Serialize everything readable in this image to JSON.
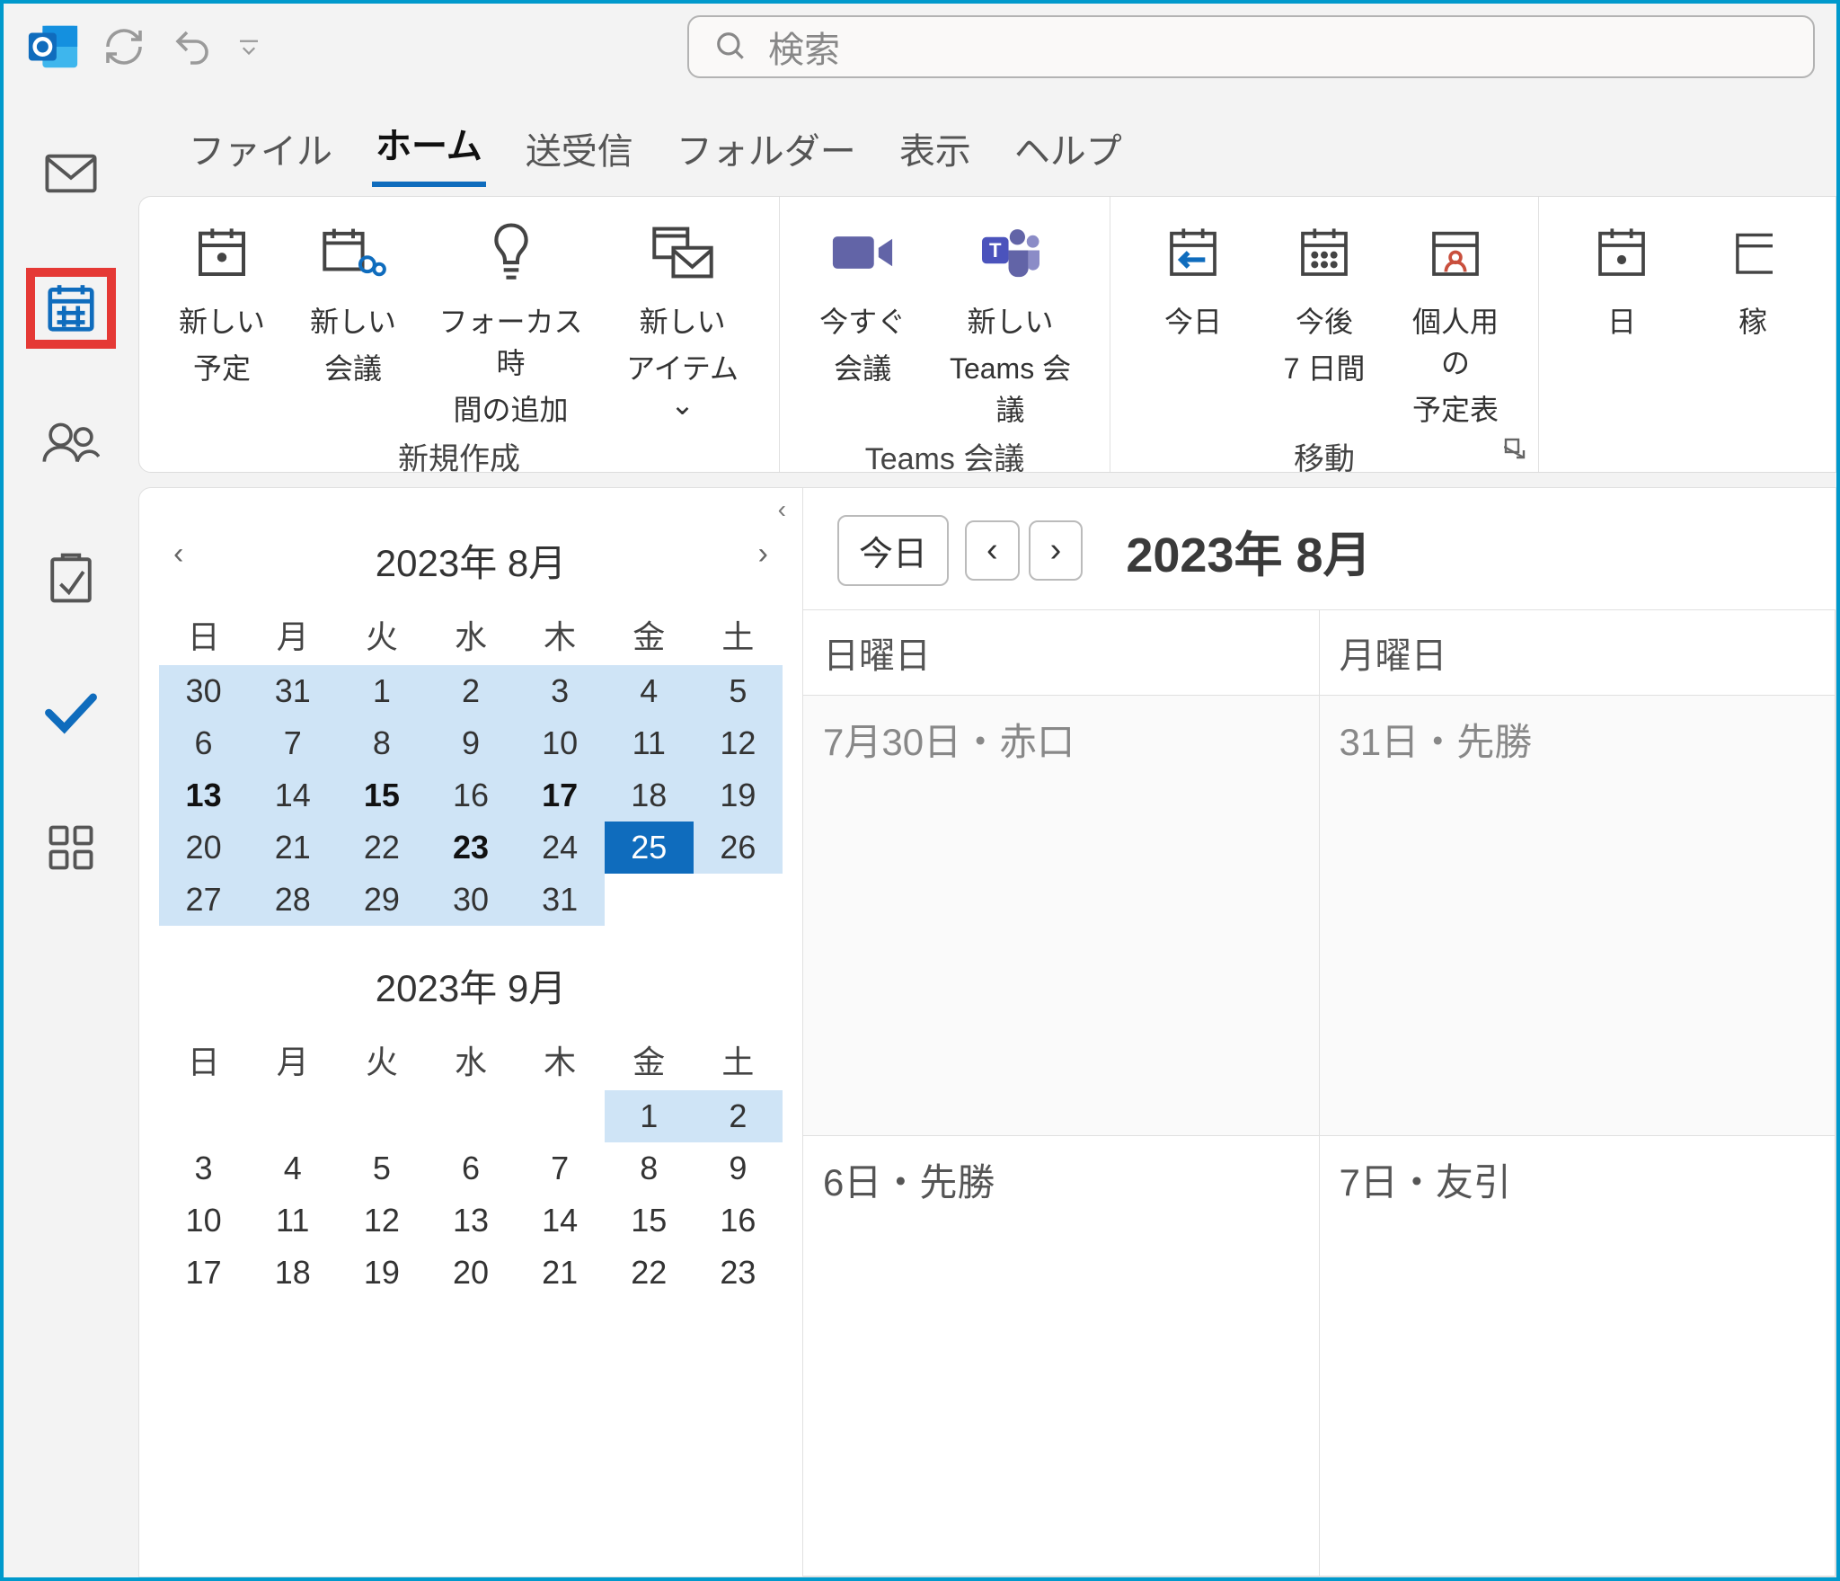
{
  "titlebar": {
    "search_placeholder": "検索"
  },
  "tabs": [
    "ファイル",
    "ホーム",
    "送受信",
    "フォルダー",
    "表示",
    "ヘルプ"
  ],
  "tabs_active_index": 1,
  "ribbon": {
    "groups": [
      {
        "label": "新規作成",
        "buttons": [
          {
            "line1": "新しい",
            "line2": "予定"
          },
          {
            "line1": "新しい",
            "line2": "会議"
          },
          {
            "line1": "フォーカス時",
            "line2": "間の追加"
          },
          {
            "line1": "新しい",
            "line2": "アイテム ⌄"
          }
        ]
      },
      {
        "label": "Teams 会議",
        "buttons": [
          {
            "line1": "今すぐ",
            "line2": "会議"
          },
          {
            "line1": "新しい",
            "line2": "Teams 会議"
          }
        ]
      },
      {
        "label": "移動",
        "buttons": [
          {
            "line1": "今日",
            "line2": ""
          },
          {
            "line1": "今後",
            "line2": "7 日間"
          },
          {
            "line1": "個人用の",
            "line2": "予定表"
          }
        ],
        "has_launcher": true
      },
      {
        "label": "",
        "buttons": [
          {
            "line1": "日",
            "line2": ""
          },
          {
            "line1": "稼",
            "line2": ""
          }
        ]
      }
    ]
  },
  "minicals": [
    {
      "title": "2023年 8月",
      "show_nav": true,
      "dow": [
        "日",
        "月",
        "火",
        "水",
        "木",
        "金",
        "土"
      ],
      "weeks": [
        [
          {
            "n": 30,
            "range": true,
            "dim": false
          },
          {
            "n": 31,
            "range": true
          },
          {
            "n": 1,
            "range": true
          },
          {
            "n": 2,
            "range": true
          },
          {
            "n": 3,
            "range": true
          },
          {
            "n": 4,
            "range": true
          },
          {
            "n": 5,
            "range": true
          }
        ],
        [
          {
            "n": 6,
            "range": true
          },
          {
            "n": 7,
            "range": true
          },
          {
            "n": 8,
            "range": true
          },
          {
            "n": 9,
            "range": true
          },
          {
            "n": 10,
            "range": true
          },
          {
            "n": 11,
            "range": true
          },
          {
            "n": 12,
            "range": true
          }
        ],
        [
          {
            "n": 13,
            "range": true,
            "bold": true
          },
          {
            "n": 14,
            "range": true
          },
          {
            "n": 15,
            "range": true,
            "bold": true
          },
          {
            "n": 16,
            "range": true
          },
          {
            "n": 17,
            "range": true,
            "bold": true
          },
          {
            "n": 18,
            "range": true
          },
          {
            "n": 19,
            "range": true
          }
        ],
        [
          {
            "n": 20,
            "range": true
          },
          {
            "n": 21,
            "range": true
          },
          {
            "n": 22,
            "range": true
          },
          {
            "n": 23,
            "range": true,
            "bold": true
          },
          {
            "n": 24,
            "range": true
          },
          {
            "n": 25,
            "today": true
          },
          {
            "n": 26,
            "range": true
          }
        ],
        [
          {
            "n": 27,
            "range": true
          },
          {
            "n": 28,
            "range": true
          },
          {
            "n": 29,
            "range": true
          },
          {
            "n": 30,
            "range": true
          },
          {
            "n": 31,
            "range": true
          },
          {
            "n": "",
            "blank": true
          },
          {
            "n": "",
            "blank": true
          }
        ]
      ]
    },
    {
      "title": "2023年 9月",
      "show_nav": false,
      "dow": [
        "日",
        "月",
        "火",
        "水",
        "木",
        "金",
        "土"
      ],
      "weeks": [
        [
          {
            "n": "",
            "blank": true
          },
          {
            "n": "",
            "blank": true
          },
          {
            "n": "",
            "blank": true
          },
          {
            "n": "",
            "blank": true
          },
          {
            "n": "",
            "blank": true
          },
          {
            "n": 1,
            "range": true
          },
          {
            "n": 2,
            "range": true
          }
        ],
        [
          {
            "n": 3
          },
          {
            "n": 4
          },
          {
            "n": 5
          },
          {
            "n": 6
          },
          {
            "n": 7
          },
          {
            "n": 8
          },
          {
            "n": 9
          }
        ],
        [
          {
            "n": 10
          },
          {
            "n": 11
          },
          {
            "n": 12
          },
          {
            "n": 13
          },
          {
            "n": 14
          },
          {
            "n": 15
          },
          {
            "n": 16
          }
        ],
        [
          {
            "n": 17
          },
          {
            "n": 18
          },
          {
            "n": 19
          },
          {
            "n": 20
          },
          {
            "n": 21
          },
          {
            "n": 22
          },
          {
            "n": 23
          }
        ]
      ]
    }
  ],
  "calview": {
    "today_btn": "今日",
    "title": "2023年 8月",
    "day_headers": [
      "日曜日",
      "月曜日"
    ],
    "cells": [
      [
        {
          "text": "7月30日・赤口",
          "dim": true
        },
        {
          "text": "31日・先勝",
          "dim": true
        }
      ],
      [
        {
          "text": "6日・先勝"
        },
        {
          "text": "7日・友引"
        }
      ]
    ]
  }
}
